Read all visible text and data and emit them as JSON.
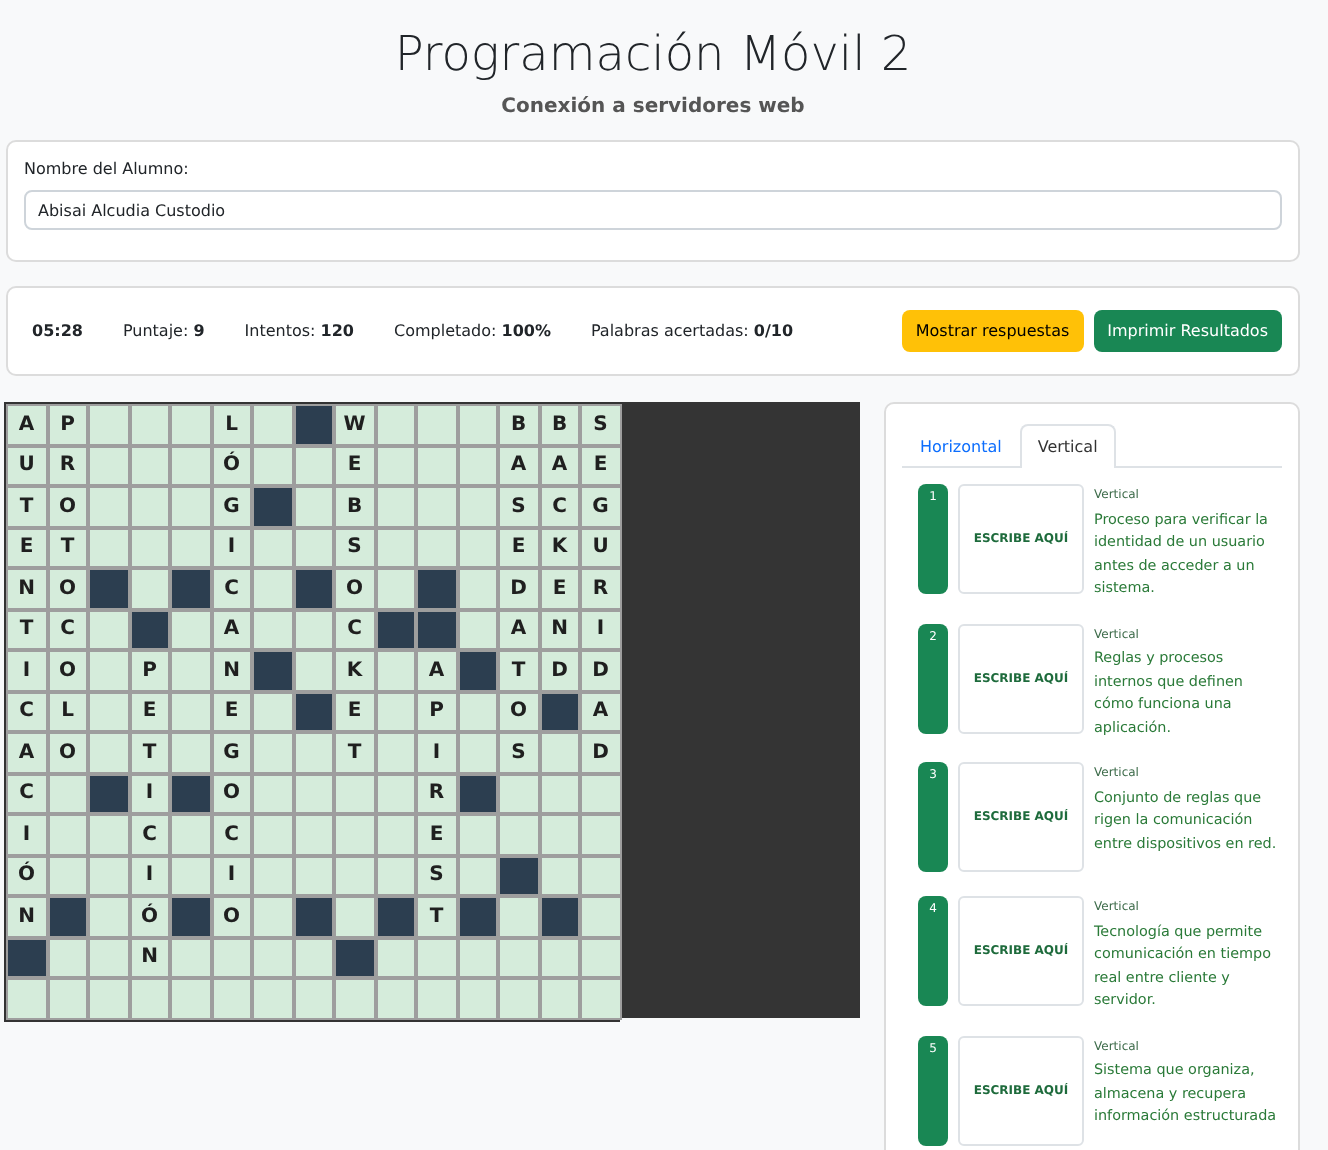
{
  "header": {
    "title": "Programación Móvil 2",
    "subtitle": "Conexión a servidores web"
  },
  "student": {
    "label": "Nombre del Alumno:",
    "value": "Abisai Alcudia Custodio"
  },
  "stats": [
    {
      "label": "Puntaje:",
      "value": "9"
    },
    {
      "label": "Intentos:",
      "value": "120"
    },
    {
      "label": "Completado:",
      "value": "100%"
    },
    {
      "label": "Palabras acertadas:",
      "value": "0/10"
    }
  ],
  "timer": "05:28",
  "buttons": [
    {
      "label": "Mostrar respuestas",
      "kind": "warning"
    },
    {
      "label": "Imprimir Resultados",
      "kind": "success"
    }
  ],
  "grid": {
    "rows": [
      [
        {
          "kind": "letter",
          "letter": "A"
        },
        {
          "kind": "letter",
          "letter": "P"
        },
        {
          "kind": "open"
        },
        {
          "kind": "open"
        },
        {
          "kind": "open"
        },
        {
          "kind": "letter",
          "letter": "L"
        },
        {
          "kind": "open"
        },
        {
          "kind": "block"
        },
        {
          "kind": "letter",
          "letter": "W"
        },
        {
          "kind": "open"
        },
        {
          "kind": "open"
        },
        {
          "kind": "open"
        },
        {
          "kind": "letter",
          "letter": "B"
        },
        {
          "kind": "letter",
          "letter": "B"
        },
        {
          "kind": "letter",
          "letter": "S"
        }
      ],
      [
        {
          "kind": "letter",
          "letter": "U"
        },
        {
          "kind": "letter",
          "letter": "R"
        },
        {
          "kind": "open"
        },
        {
          "kind": "open"
        },
        {
          "kind": "open"
        },
        {
          "kind": "letter",
          "letter": "Ó"
        },
        {
          "kind": "open"
        },
        {
          "kind": "open"
        },
        {
          "kind": "letter",
          "letter": "E"
        },
        {
          "kind": "open"
        },
        {
          "kind": "open"
        },
        {
          "kind": "open"
        },
        {
          "kind": "letter",
          "letter": "A"
        },
        {
          "kind": "letter",
          "letter": "A"
        },
        {
          "kind": "letter",
          "letter": "E"
        }
      ],
      [
        {
          "kind": "letter",
          "letter": "T"
        },
        {
          "kind": "letter",
          "letter": "O"
        },
        {
          "kind": "open"
        },
        {
          "kind": "open"
        },
        {
          "kind": "open"
        },
        {
          "kind": "letter",
          "letter": "G"
        },
        {
          "kind": "block"
        },
        {
          "kind": "open"
        },
        {
          "kind": "letter",
          "letter": "B"
        },
        {
          "kind": "open"
        },
        {
          "kind": "open"
        },
        {
          "kind": "open"
        },
        {
          "kind": "letter",
          "letter": "S"
        },
        {
          "kind": "letter",
          "letter": "C"
        },
        {
          "kind": "letter",
          "letter": "G"
        }
      ],
      [
        {
          "kind": "letter",
          "letter": "E"
        },
        {
          "kind": "letter",
          "letter": "T"
        },
        {
          "kind": "open"
        },
        {
          "kind": "open"
        },
        {
          "kind": "open"
        },
        {
          "kind": "letter",
          "letter": "I"
        },
        {
          "kind": "open"
        },
        {
          "kind": "open"
        },
        {
          "kind": "letter",
          "letter": "S"
        },
        {
          "kind": "open"
        },
        {
          "kind": "open"
        },
        {
          "kind": "open"
        },
        {
          "kind": "letter",
          "letter": "E"
        },
        {
          "kind": "letter",
          "letter": "K"
        },
        {
          "kind": "letter",
          "letter": "U"
        }
      ],
      [
        {
          "kind": "letter",
          "letter": "N"
        },
        {
          "kind": "letter",
          "letter": "O"
        },
        {
          "kind": "block"
        },
        {
          "kind": "open"
        },
        {
          "kind": "block"
        },
        {
          "kind": "letter",
          "letter": "C"
        },
        {
          "kind": "open"
        },
        {
          "kind": "block"
        },
        {
          "kind": "letter",
          "letter": "O"
        },
        {
          "kind": "open"
        },
        {
          "kind": "block"
        },
        {
          "kind": "open"
        },
        {
          "kind": "letter",
          "letter": "D"
        },
        {
          "kind": "letter",
          "letter": "E"
        },
        {
          "kind": "letter",
          "letter": "R"
        }
      ],
      [
        {
          "kind": "letter",
          "letter": "T"
        },
        {
          "kind": "letter",
          "letter": "C"
        },
        {
          "kind": "open"
        },
        {
          "kind": "block"
        },
        {
          "kind": "open"
        },
        {
          "kind": "letter",
          "letter": "A"
        },
        {
          "kind": "open"
        },
        {
          "kind": "open"
        },
        {
          "kind": "letter",
          "letter": "C"
        },
        {
          "kind": "block"
        },
        {
          "kind": "block"
        },
        {
          "kind": "open"
        },
        {
          "kind": "letter",
          "letter": "A"
        },
        {
          "kind": "letter",
          "letter": "N"
        },
        {
          "kind": "letter",
          "letter": "I"
        }
      ],
      [
        {
          "kind": "letter",
          "letter": "I"
        },
        {
          "kind": "letter",
          "letter": "O"
        },
        {
          "kind": "open"
        },
        {
          "kind": "letter",
          "letter": "P"
        },
        {
          "kind": "open"
        },
        {
          "kind": "letter",
          "letter": "N"
        },
        {
          "kind": "block"
        },
        {
          "kind": "open"
        },
        {
          "kind": "letter",
          "letter": "K"
        },
        {
          "kind": "open"
        },
        {
          "kind": "letter",
          "letter": "A"
        },
        {
          "kind": "block"
        },
        {
          "kind": "letter",
          "letter": "T"
        },
        {
          "kind": "letter",
          "letter": "D"
        },
        {
          "kind": "letter",
          "letter": "D"
        }
      ],
      [
        {
          "kind": "letter",
          "letter": "C"
        },
        {
          "kind": "letter",
          "letter": "L"
        },
        {
          "kind": "open"
        },
        {
          "kind": "letter",
          "letter": "E"
        },
        {
          "kind": "open"
        },
        {
          "kind": "letter",
          "letter": "E"
        },
        {
          "kind": "open"
        },
        {
          "kind": "block"
        },
        {
          "kind": "letter",
          "letter": "E"
        },
        {
          "kind": "open"
        },
        {
          "kind": "letter",
          "letter": "P"
        },
        {
          "kind": "open"
        },
        {
          "kind": "letter",
          "letter": "O"
        },
        {
          "kind": "block"
        },
        {
          "kind": "letter",
          "letter": "A"
        }
      ],
      [
        {
          "kind": "letter",
          "letter": "A"
        },
        {
          "kind": "letter",
          "letter": "O"
        },
        {
          "kind": "open"
        },
        {
          "kind": "letter",
          "letter": "T"
        },
        {
          "kind": "open"
        },
        {
          "kind": "letter",
          "letter": "G"
        },
        {
          "kind": "open"
        },
        {
          "kind": "open"
        },
        {
          "kind": "letter",
          "letter": "T"
        },
        {
          "kind": "open"
        },
        {
          "kind": "letter",
          "letter": "I"
        },
        {
          "kind": "open"
        },
        {
          "kind": "letter",
          "letter": "S"
        },
        {
          "kind": "open"
        },
        {
          "kind": "letter",
          "letter": "D"
        }
      ],
      [
        {
          "kind": "letter",
          "letter": "C"
        },
        {
          "kind": "open"
        },
        {
          "kind": "block"
        },
        {
          "kind": "letter",
          "letter": "I"
        },
        {
          "kind": "block"
        },
        {
          "kind": "letter",
          "letter": "O"
        },
        {
          "kind": "open"
        },
        {
          "kind": "open"
        },
        {
          "kind": "open"
        },
        {
          "kind": "open"
        },
        {
          "kind": "letter",
          "letter": "R"
        },
        {
          "kind": "block"
        },
        {
          "kind": "open"
        },
        {
          "kind": "open"
        },
        {
          "kind": "open"
        }
      ],
      [
        {
          "kind": "letter",
          "letter": "I"
        },
        {
          "kind": "open"
        },
        {
          "kind": "open"
        },
        {
          "kind": "letter",
          "letter": "C"
        },
        {
          "kind": "open"
        },
        {
          "kind": "letter",
          "letter": "C"
        },
        {
          "kind": "open"
        },
        {
          "kind": "open"
        },
        {
          "kind": "open"
        },
        {
          "kind": "open"
        },
        {
          "kind": "letter",
          "letter": "E"
        },
        {
          "kind": "open"
        },
        {
          "kind": "open"
        },
        {
          "kind": "open"
        },
        {
          "kind": "open"
        }
      ],
      [
        {
          "kind": "letter",
          "letter": "Ó"
        },
        {
          "kind": "open"
        },
        {
          "kind": "open"
        },
        {
          "kind": "letter",
          "letter": "I"
        },
        {
          "kind": "open"
        },
        {
          "kind": "letter",
          "letter": "I"
        },
        {
          "kind": "open"
        },
        {
          "kind": "open"
        },
        {
          "kind": "open"
        },
        {
          "kind": "open"
        },
        {
          "kind": "letter",
          "letter": "S"
        },
        {
          "kind": "open"
        },
        {
          "kind": "block"
        },
        {
          "kind": "open"
        },
        {
          "kind": "open"
        }
      ],
      [
        {
          "kind": "letter",
          "letter": "N"
        },
        {
          "kind": "block"
        },
        {
          "kind": "open"
        },
        {
          "kind": "letter",
          "letter": "Ó"
        },
        {
          "kind": "block"
        },
        {
          "kind": "letter",
          "letter": "O"
        },
        {
          "kind": "open"
        },
        {
          "kind": "block"
        },
        {
          "kind": "open"
        },
        {
          "kind": "block"
        },
        {
          "kind": "letter",
          "letter": "T"
        },
        {
          "kind": "block"
        },
        {
          "kind": "open"
        },
        {
          "kind": "block"
        },
        {
          "kind": "open"
        }
      ],
      [
        {
          "kind": "block"
        },
        {
          "kind": "open"
        },
        {
          "kind": "open"
        },
        {
          "kind": "letter",
          "letter": "N"
        },
        {
          "kind": "open"
        },
        {
          "kind": "open"
        },
        {
          "kind": "open"
        },
        {
          "kind": "open"
        },
        {
          "kind": "block"
        },
        {
          "kind": "open"
        },
        {
          "kind": "open"
        },
        {
          "kind": "open"
        },
        {
          "kind": "open"
        },
        {
          "kind": "open"
        },
        {
          "kind": "open"
        }
      ],
      [
        {
          "kind": "open"
        },
        {
          "kind": "open"
        },
        {
          "kind": "open"
        },
        {
          "kind": "open"
        },
        {
          "kind": "open"
        },
        {
          "kind": "open"
        },
        {
          "kind": "open"
        },
        {
          "kind": "open"
        },
        {
          "kind": "open"
        },
        {
          "kind": "open"
        },
        {
          "kind": "open"
        },
        {
          "kind": "open"
        },
        {
          "kind": "open"
        },
        {
          "kind": "open"
        },
        {
          "kind": "open"
        }
      ]
    ]
  },
  "tabs": [
    {
      "label": "Horizontal",
      "selected": false
    },
    {
      "label": "Vertical",
      "selected": true
    }
  ],
  "clues": [
    {
      "number": "1",
      "answer": "ESCRIBE AQUÍ",
      "direction": "Vertical",
      "text": "Proceso para verificar la identidad de un usuario antes de acceder a un sistema.",
      "done": true
    },
    {
      "number": "2",
      "answer": "ESCRIBE AQUÍ",
      "direction": "Vertical",
      "text": "Reglas y procesos internos que definen cómo funciona una aplicación.",
      "done": true
    },
    {
      "number": "3",
      "answer": "ESCRIBE AQUÍ",
      "direction": "Vertical",
      "text": "Conjunto de reglas que rigen la comunicación entre dispositivos en red.",
      "done": true
    },
    {
      "number": "4",
      "answer": "ESCRIBE AQUÍ",
      "direction": "Vertical",
      "text": "Tecnología que permite comunicación en tiempo real entre cliente y servidor.",
      "done": true
    },
    {
      "number": "5",
      "answer": "ESCRIBE AQUÍ",
      "direction": "Vertical",
      "text": "Sistema que organiza, almacena y recupera información estructurada",
      "done": true
    }
  ]
}
